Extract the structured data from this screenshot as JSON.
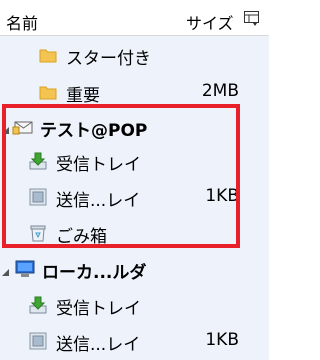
{
  "header": {
    "name_label": "名前",
    "size_label": "サイズ",
    "column_menu_icon": "column-chooser-icon"
  },
  "tree": {
    "items": [
      {
        "label": "スター付き",
        "size": "",
        "icon": "folder-icon",
        "bold": false
      },
      {
        "label": "重要",
        "size": "2MB",
        "icon": "folder-icon",
        "bold": false
      },
      {
        "label": "テスト@POP",
        "size": "",
        "icon": "mail-account-icon",
        "bold": true
      },
      {
        "label": "受信トレイ",
        "size": "",
        "icon": "inbox-icon",
        "bold": false
      },
      {
        "label": "送信...レイ",
        "size": "1KB",
        "icon": "outbox-icon",
        "bold": false
      },
      {
        "label": "ごみ箱",
        "size": "",
        "icon": "trash-icon",
        "bold": false
      },
      {
        "label": "ローカ...ルダ",
        "size": "",
        "icon": "local-folders-icon",
        "bold": true
      },
      {
        "label": "受信トレイ",
        "size": "",
        "icon": "inbox-icon",
        "bold": false
      },
      {
        "label": "送信...レイ",
        "size": "1KB",
        "icon": "outbox-icon",
        "bold": false
      }
    ]
  },
  "colors": {
    "tree_background": "#eef3fb",
    "highlight_border": "#e8202a",
    "folder_yellow": "#f4c452",
    "inbox_green": "#3fa535"
  }
}
